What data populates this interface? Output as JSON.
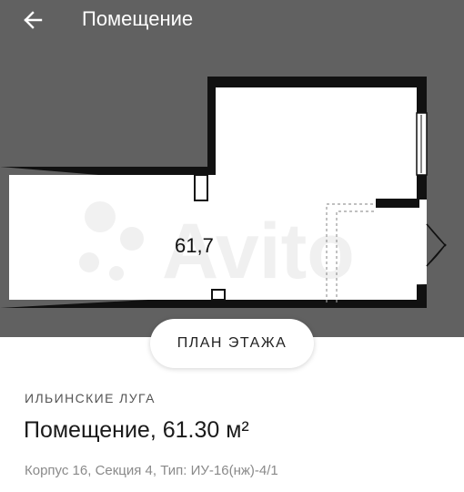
{
  "app_bar": {
    "title": "Помещение"
  },
  "icons": {
    "back": "arrow-left-icon"
  },
  "floor_plan": {
    "area_label": "61,7",
    "watermark": "Avito"
  },
  "plan_button": {
    "label": "ПЛАН ЭТАЖА"
  },
  "listing": {
    "complex_name": "ИЛЬИНСКИЕ ЛУГА",
    "title": "Помещение, 61.30 м²",
    "details": "Корпус 16, Секция 4, Тип: ИУ-16(нж)-4/1"
  },
  "colors": {
    "top_background": "#616161",
    "wall": "#111111",
    "room_fill": "#ffffff",
    "text_primary": "#1a1a1a",
    "text_secondary": "#8a8a8a"
  }
}
